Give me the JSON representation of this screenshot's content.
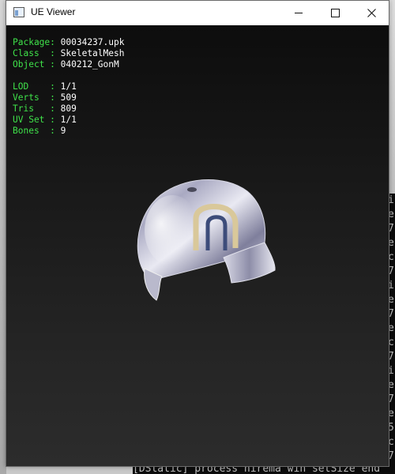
{
  "window": {
    "title": "UE Viewer",
    "controls": [
      "minimize",
      "maximize",
      "close"
    ]
  },
  "info": {
    "object_lines": [
      {
        "key": "Package:",
        "value": "00034237.upk"
      },
      {
        "key": "Class  :",
        "value": "SkeletalMesh"
      },
      {
        "key": "Object :",
        "value": "040212_GonM"
      }
    ],
    "mesh_lines": [
      {
        "key": "LOD    :",
        "value": "1/1"
      },
      {
        "key": "Verts  :",
        "value": "509"
      },
      {
        "key": "Tris   :",
        "value": "809"
      },
      {
        "key": "UV Set :",
        "value": "1/1"
      },
      {
        "key": "Bones  :",
        "value": "9"
      }
    ]
  },
  "background_console": {
    "right_column": [
      "i",
      "e",
      "7",
      "e",
      "c",
      "7",
      "i",
      "e",
      "7",
      "e",
      "c",
      "7",
      "i",
      "e",
      "7",
      "e",
      "5",
      "c",
      "7"
    ],
    "bottom_text": "[DStatic] process  hirema win setSize  end"
  },
  "colors": {
    "label_green": "#3fe24a",
    "value_white": "#ffffff",
    "titlebar": "#ffffff",
    "viewport_dark": "#1a1a1a"
  }
}
